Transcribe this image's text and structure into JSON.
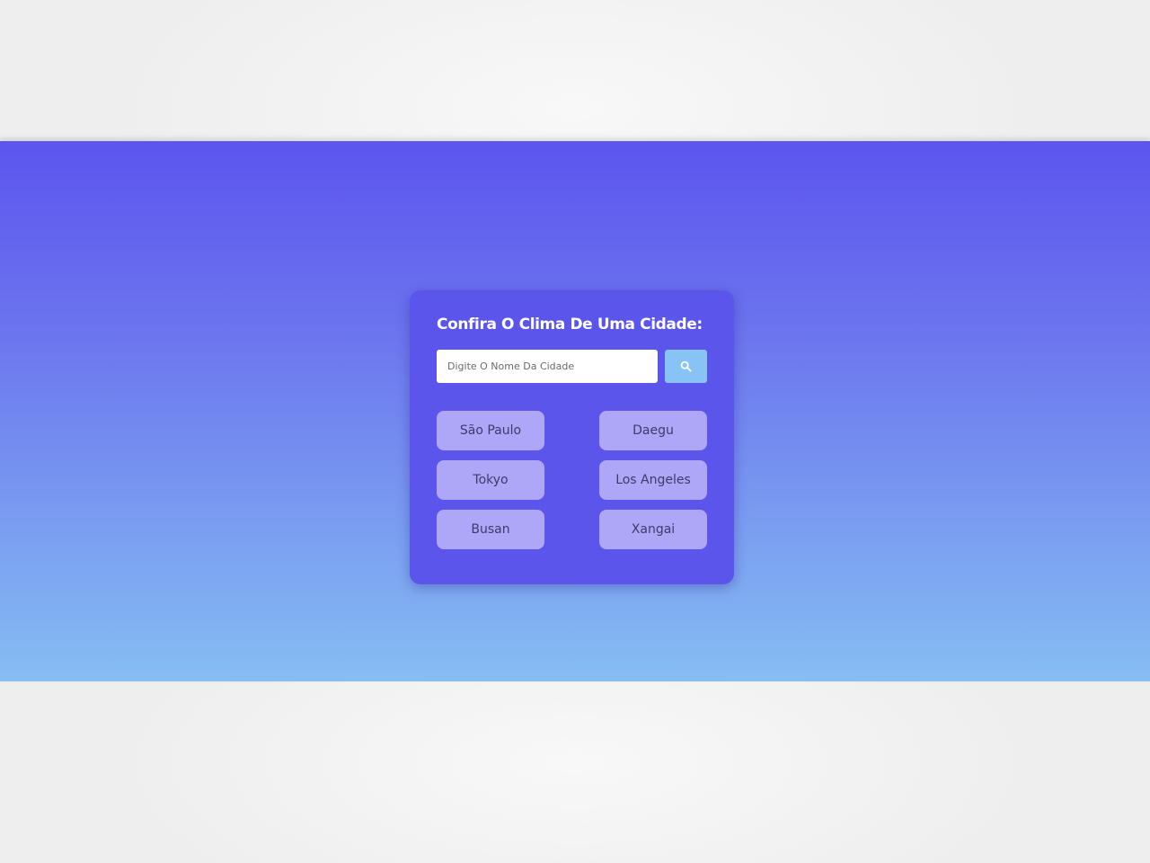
{
  "weather_widget": {
    "title": "Confira O Clima De Uma Cidade:",
    "search": {
      "placeholder": "Digite O Nome Da Cidade",
      "value": "",
      "button_icon": "search-icon"
    },
    "cities": [
      {
        "label": "São Paulo"
      },
      {
        "label": "Daegu"
      },
      {
        "label": "Tokyo"
      },
      {
        "label": "Los Angeles"
      },
      {
        "label": "Busan"
      },
      {
        "label": "Xangai"
      }
    ]
  },
  "colors": {
    "gradient_top": "#5c55ee",
    "gradient_bottom": "#86bdf3",
    "card_background": "#5b55ec",
    "city_button": "#aea6f6",
    "search_button": "#87c4f5",
    "title_text": "#ffffff"
  }
}
